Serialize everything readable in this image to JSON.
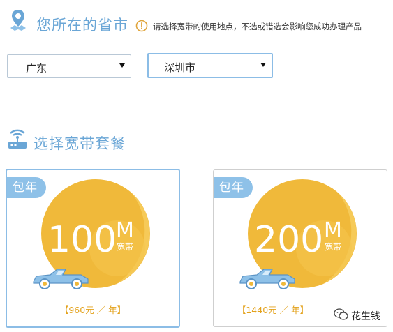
{
  "location_section": {
    "title": "您所在的省市",
    "icon": "location-pin-icon",
    "notice_icon": "warning-circle-icon",
    "notice": "请选择宽带的使用地点，不选或错选会影响您成功办理产品"
  },
  "province_select": {
    "value": "广东"
  },
  "city_select": {
    "value": "深圳市"
  },
  "package_section": {
    "title": "选择宽带套餐",
    "icon": "router-icon"
  },
  "packages": [
    {
      "tag": "包年",
      "speed": "100",
      "unit": "M",
      "sub": "宽带",
      "price": "【960元 ／ 年】",
      "selected": true
    },
    {
      "tag": "包年",
      "speed": "200",
      "unit": "M",
      "sub": "宽带",
      "price": "【1440元 ／ 年】",
      "selected": false
    }
  ],
  "watermark": {
    "text": "花生钱",
    "icon": "wechat-icon"
  },
  "colors": {
    "accent": "#6aa6d6",
    "tag_blue": "#8ec1e8",
    "gold": "#f0b93a",
    "price": "#e3a21c"
  }
}
